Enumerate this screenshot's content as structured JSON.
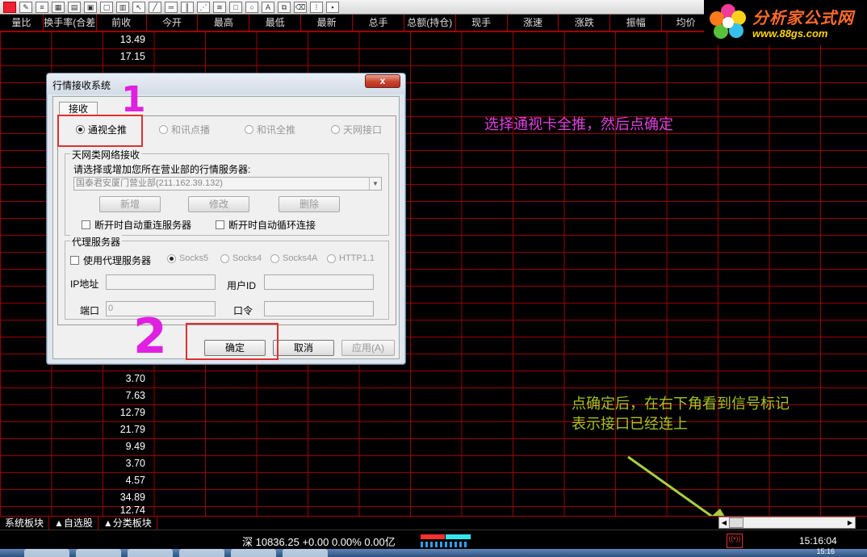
{
  "header": {
    "columns": [
      "量比",
      "换手率(合差",
      "前收",
      "今开",
      "最高",
      "最低",
      "最新",
      "总手",
      "总额(持仓)",
      "现手",
      "涨速",
      "涨跌",
      "振幅",
      "均价"
    ]
  },
  "table": {
    "prev_close_top": [
      "13.49",
      "17.15",
      "",
      ""
    ],
    "prev_close_bottom": [
      "3.70",
      "7.63",
      "12.79",
      "21.79",
      "9.49",
      "3.70",
      "4.57",
      "34.89",
      "12.74"
    ]
  },
  "logo": {
    "title": "分析家公式网",
    "url": "www.88gs.com"
  },
  "annotations": {
    "step1_note": "选择通视卡全推，然后点确定",
    "step2_note_line1": "点确定后，在右下角看到信号标记",
    "step2_note_line2": "表示接口已经连上",
    "mark1": "1",
    "mark2": "2"
  },
  "dialog": {
    "title": "行情接收系统",
    "close_label": "x",
    "tab_label": "接收",
    "radios": [
      {
        "label": "通视全推",
        "selected": true,
        "enabled": true
      },
      {
        "label": "和讯点播",
        "selected": false,
        "enabled": false
      },
      {
        "label": "和讯全推",
        "selected": false,
        "enabled": false
      },
      {
        "label": "天网接口",
        "selected": false,
        "enabled": false
      }
    ],
    "network_group_label": "天网类网络接收",
    "server_prompt": "请选择或增加您所在营业部的行情服务器:",
    "server_selected": "国泰君安厦门营业部(211.162.39.132)",
    "btn_add": "新增",
    "btn_edit": "修改",
    "btn_delete": "删除",
    "chk_auto_reconnect": "断开时自动重连服务器",
    "chk_auto_cycle": "断开时自动循环连接",
    "proxy_group_label": "代理服务器",
    "chk_use_proxy": "使用代理服务器",
    "proxy_types": [
      "Socks5",
      "Socks4",
      "Socks4A",
      "HTTP1.1"
    ],
    "ip_label": "IP地址",
    "user_label": "用户ID",
    "port_label": "端口",
    "port_value": "0",
    "password_label": "口令",
    "btn_ok": "确定",
    "btn_cancel": "取消",
    "btn_apply": "应用(A)"
  },
  "sheet_tabs": [
    "系统板块",
    "▲自选股",
    "▲分类板块"
  ],
  "status": {
    "index_text": "深 10836.25 +0.00 0.00% 0.00亿",
    "signal_icon": "signal-icon",
    "clock": "15:16:04",
    "taskbar_clock": "15:16"
  },
  "colors": {
    "grid_line": "#aa0000",
    "note1": "#e040e0",
    "note2": "#a8c020",
    "highlight_box": "#e03030",
    "arrow": "#a8d040"
  }
}
